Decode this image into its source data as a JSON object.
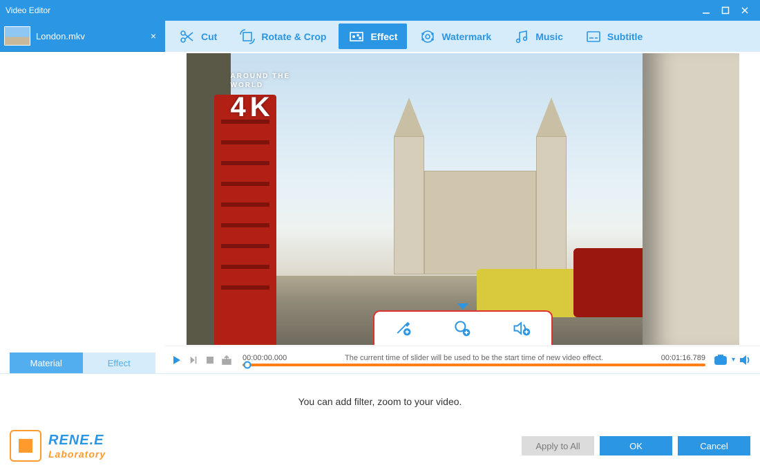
{
  "window": {
    "title": "Video Editor"
  },
  "file_tab": {
    "name": "London.mkv"
  },
  "sidebar_tabs": {
    "material": "Material",
    "effect": "Effect",
    "active": "material"
  },
  "toolbar": {
    "cut": "Cut",
    "rotate_crop": "Rotate & Crop",
    "effect": "Effect",
    "watermark": "Watermark",
    "music": "Music",
    "subtitle": "Subtitle",
    "active": "effect"
  },
  "preview": {
    "watermark_line1": "AROUND THE",
    "watermark_line2": "WORLD",
    "watermark_big": "4K"
  },
  "quickbar": {
    "filter_icon": "magic-wand-plus-icon",
    "zoom_icon": "magnify-plus-icon",
    "volume_icon": "speaker-plus-icon"
  },
  "timeline": {
    "current": "00:00:00.000",
    "hint": "The current time of slider will be used to be the start time of new video effect.",
    "total": "00:01:16.789",
    "position_pct": 1
  },
  "bottom": {
    "message": "You can add filter, zoom to your video.",
    "brand_line1": "RENE.E",
    "brand_line2": "Laboratory",
    "apply_all": "Apply to All",
    "ok": "OK",
    "cancel": "Cancel"
  }
}
